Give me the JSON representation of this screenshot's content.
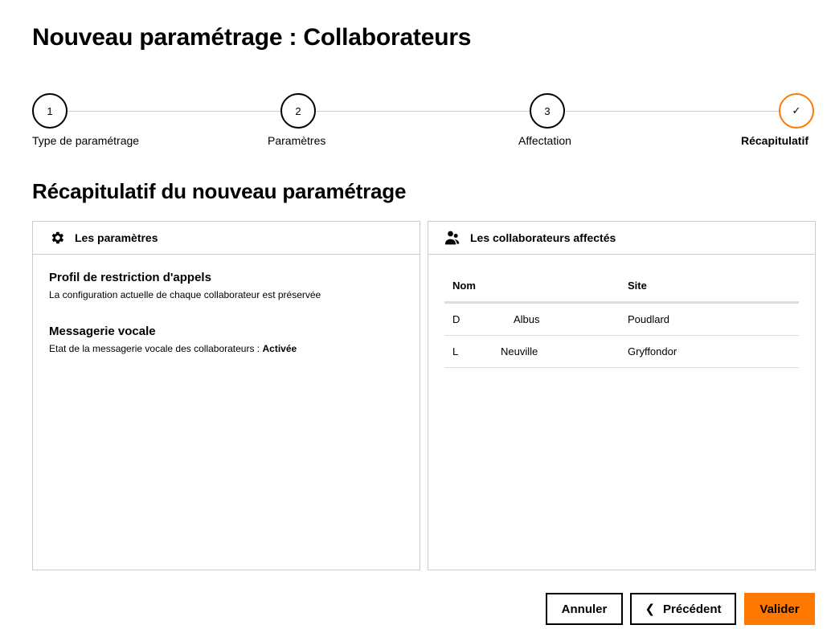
{
  "page": {
    "title": "Nouveau paramétrage : Collaborateurs"
  },
  "stepper": {
    "steps": [
      {
        "number": "1",
        "label": "Type de paramétrage"
      },
      {
        "number": "2",
        "label": "Paramètres"
      },
      {
        "number": "3",
        "label": "Affectation"
      },
      {
        "number": "✓",
        "label": "Récapitulatif"
      }
    ],
    "active_step": 4
  },
  "summary": {
    "title": "Récapitulatif du nouveau paramétrage"
  },
  "params_panel": {
    "header": "Les paramètres",
    "icon": "gear-icon",
    "items": [
      {
        "title": "Profil de restriction d'appels",
        "description": "La configuration actuelle de chaque collaborateur est préservée"
      },
      {
        "title": "Messagerie vocale",
        "description": "Etat de la messagerie vocale des collaborateurs : ",
        "value": "Activée"
      }
    ]
  },
  "collaborators_panel": {
    "header": "Les collaborateurs affectés",
    "icon": "users-icon",
    "columns": {
      "nom": "Nom",
      "site": "Site"
    },
    "rows": [
      {
        "nom": "D",
        "prenom": "Albus",
        "site": "Poudlard"
      },
      {
        "nom": "L",
        "prenom": "Neuville",
        "site": "Gryffondor"
      }
    ]
  },
  "actions": {
    "cancel": "Annuler",
    "previous": "Précédent",
    "validate": "Valider"
  },
  "colors": {
    "accent": "#ff7900",
    "border": "#cccccc"
  }
}
